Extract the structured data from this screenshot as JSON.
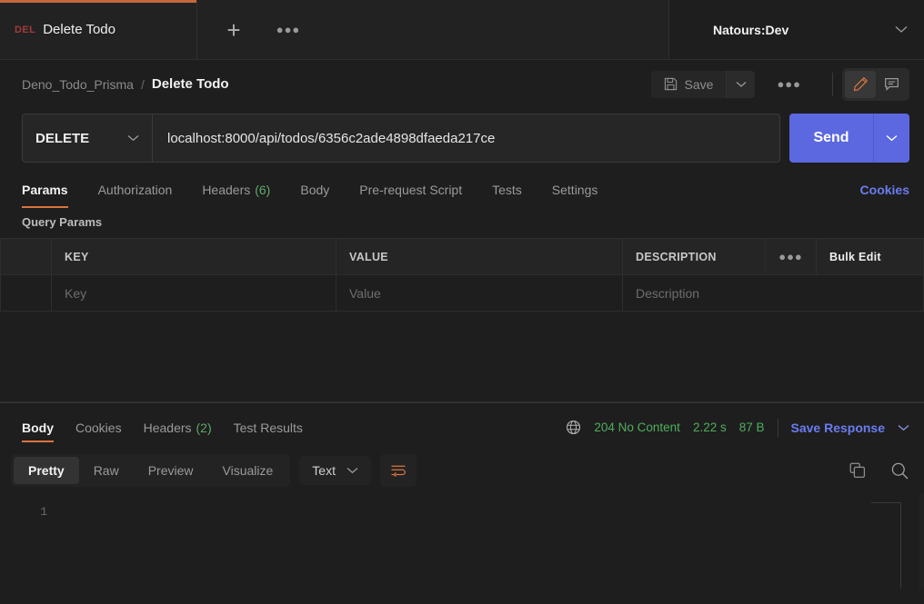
{
  "tabbar": {
    "request_tab": {
      "method_badge": "DEL",
      "name": "Delete Todo"
    },
    "new_tab_icon": "plus-icon",
    "tab_more_icon": "ellipsis-icon",
    "environment": {
      "name": "Natours:Dev",
      "caret": "chevron-down-icon"
    }
  },
  "breadcrumb": {
    "collection": "Deno_Todo_Prisma",
    "separator": "/",
    "current": "Delete Todo"
  },
  "toolbar": {
    "save_label": "Save",
    "save_icon": "floppy-disk-icon",
    "save_caret_icon": "chevron-down-icon",
    "more_icon": "ellipsis-icon",
    "edit_icon": "pencil-icon",
    "comment_icon": "comment-icon"
  },
  "request": {
    "method": "DELETE",
    "method_caret_icon": "chevron-down-icon",
    "url": "localhost:8000/api/todos/6356c2ade4898dfaeda217ce",
    "send_label": "Send",
    "send_caret_icon": "chevron-down-icon"
  },
  "request_tabs": [
    {
      "label": "Params",
      "count": null,
      "active": true
    },
    {
      "label": "Authorization",
      "count": null,
      "active": false
    },
    {
      "label": "Headers",
      "count": "(6)",
      "active": false
    },
    {
      "label": "Body",
      "count": null,
      "active": false
    },
    {
      "label": "Pre-request Script",
      "count": null,
      "active": false
    },
    {
      "label": "Tests",
      "count": null,
      "active": false
    },
    {
      "label": "Settings",
      "count": null,
      "active": false
    }
  ],
  "cookies_link": "Cookies",
  "query_params": {
    "section_title": "Query Params",
    "headers": {
      "key": "KEY",
      "value": "VALUE",
      "description": "DESCRIPTION",
      "more_icon": "ellipsis-icon",
      "bulk_edit": "Bulk Edit"
    },
    "rows": [
      {
        "key": "Key",
        "value": "Value",
        "description": "Description"
      }
    ]
  },
  "response": {
    "tabs": [
      {
        "label": "Body",
        "count": null,
        "active": true
      },
      {
        "label": "Cookies",
        "count": null,
        "active": false
      },
      {
        "label": "Headers",
        "count": "(2)",
        "active": false
      },
      {
        "label": "Test Results",
        "count": null,
        "active": false
      }
    ],
    "network_icon": "globe-icon",
    "status": "204 No Content",
    "time": "2.22 s",
    "size": "87 B",
    "save_response": "Save Response",
    "save_response_caret_icon": "chevron-down-icon",
    "view_modes": [
      {
        "label": "Pretty",
        "active": true
      },
      {
        "label": "Raw",
        "active": false
      },
      {
        "label": "Preview",
        "active": false
      },
      {
        "label": "Visualize",
        "active": false
      }
    ],
    "format": "Text",
    "format_caret_icon": "chevron-down-icon",
    "wrap_icon": "word-wrap-icon",
    "copy_icon": "copy-icon",
    "search_icon": "search-icon",
    "body_lines": [
      "1"
    ],
    "body_content": ""
  },
  "colors": {
    "accent_orange": "#d9743f",
    "send_blue": "#5b68e0",
    "link_blue": "#6b7cf0",
    "status_green": "#4fae5e",
    "count_green": "#5fa86b",
    "method_delete": "#a33b3b",
    "background": "#1e1e1e"
  }
}
